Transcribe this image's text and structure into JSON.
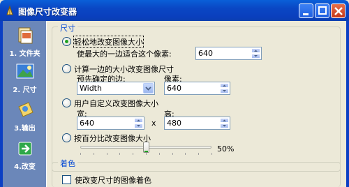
{
  "window": {
    "title": "图像尺寸改变器",
    "icon": "pen-app-icon",
    "buttons": [
      "minimize-icon",
      "maximize-icon",
      "close-icon"
    ]
  },
  "sidebar": {
    "steps": [
      {
        "label": "1. 文件夹",
        "icon": "folder-image-icon"
      },
      {
        "label": "2. 尺寸",
        "icon": "picture-resize-icon"
      },
      {
        "label": "3.输出",
        "icon": "output-folder-icon"
      },
      {
        "label": "4.改变",
        "icon": "green-arrow-icon"
      }
    ]
  },
  "size_group": {
    "title": "尺寸",
    "option1": {
      "label": "轻松地改变图像大小",
      "sub_label": "使最大的一边适合这个像素:",
      "value": "640",
      "selected": true
    },
    "option2": {
      "label": "计算一边的大小改变图像尺寸",
      "predefined_label": "预先确定的边:",
      "predefined_value": "Width",
      "pixel_label": "像素:",
      "pixel_value": "640"
    },
    "option3": {
      "label": "用户自定义改变图像大小",
      "width_label": "宽:",
      "width_value": "640",
      "times": "x",
      "height_label": "高:",
      "height_value": "480"
    },
    "option4": {
      "label": "按百分比改变图像大小",
      "percent_text": "50%",
      "slider_fraction": 0.5
    }
  },
  "color_group": {
    "title": "着色",
    "checkbox_label": "使改变尺寸的图像着色"
  },
  "colors": {
    "title_bar": "#0a47c4",
    "sidebar": "#6b87b9",
    "group_title": "#0046d5",
    "dialog_bg": "#ece9d8"
  }
}
